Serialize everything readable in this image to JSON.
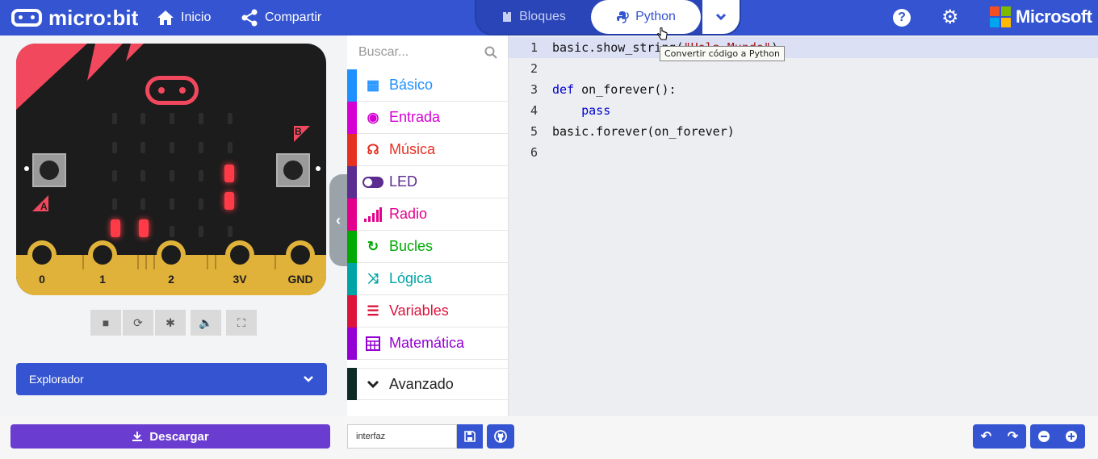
{
  "header": {
    "logo_text": "micro:bit",
    "home_label": "Inicio",
    "share_label": "Compartir",
    "tab_blocks": "Bloques",
    "tab_python": "Python",
    "help_symbol": "?",
    "brand_text": "Microsoft",
    "brand_colors": [
      "#f25022",
      "#7fba00",
      "#00a4ef",
      "#ffb900"
    ]
  },
  "simulator": {
    "pins": [
      "0",
      "1",
      "2",
      "3V",
      "GND"
    ],
    "button_a": "A",
    "button_b": "B",
    "explorer_label": "Explorador"
  },
  "toolbox": {
    "search_placeholder": "Buscar...",
    "categories": [
      {
        "label": "Básico",
        "color": "#1e90ff",
        "icon": "grid-icon"
      },
      {
        "label": "Entrada",
        "color": "#d400d4",
        "icon": "target-icon"
      },
      {
        "label": "Música",
        "color": "#e63022",
        "icon": "headphones-icon"
      },
      {
        "label": "LED",
        "color": "#5c2d91",
        "icon": "toggle-icon"
      },
      {
        "label": "Radio",
        "color": "#e3008c",
        "icon": "signal-icon"
      },
      {
        "label": "Bucles",
        "color": "#00aa00",
        "icon": "refresh-icon"
      },
      {
        "label": "Lógica",
        "color": "#00a4a6",
        "icon": "shuffle-icon"
      },
      {
        "label": "Variables",
        "color": "#dc143c",
        "icon": "lines-icon"
      },
      {
        "label": "Matemática",
        "color": "#9400d3",
        "icon": "calculator-icon"
      }
    ],
    "advanced_label": "Avanzado"
  },
  "editor": {
    "line_numbers": [
      "1",
      "2",
      "3",
      "4",
      "5",
      "6"
    ],
    "line1_a": "basic.show_s",
    "line1_b": "tring(",
    "line1_str": "\"Hola Mundo\"",
    "line1_c": ")",
    "line3_kw": "def",
    "line3_rest": " on_forever():",
    "line4_kw": "pass",
    "line5": "basic.forever(on_forever)",
    "tooltip": "Convertir código a Python"
  },
  "bottom": {
    "download_label": "Descargar",
    "project_name": "interfaz"
  }
}
